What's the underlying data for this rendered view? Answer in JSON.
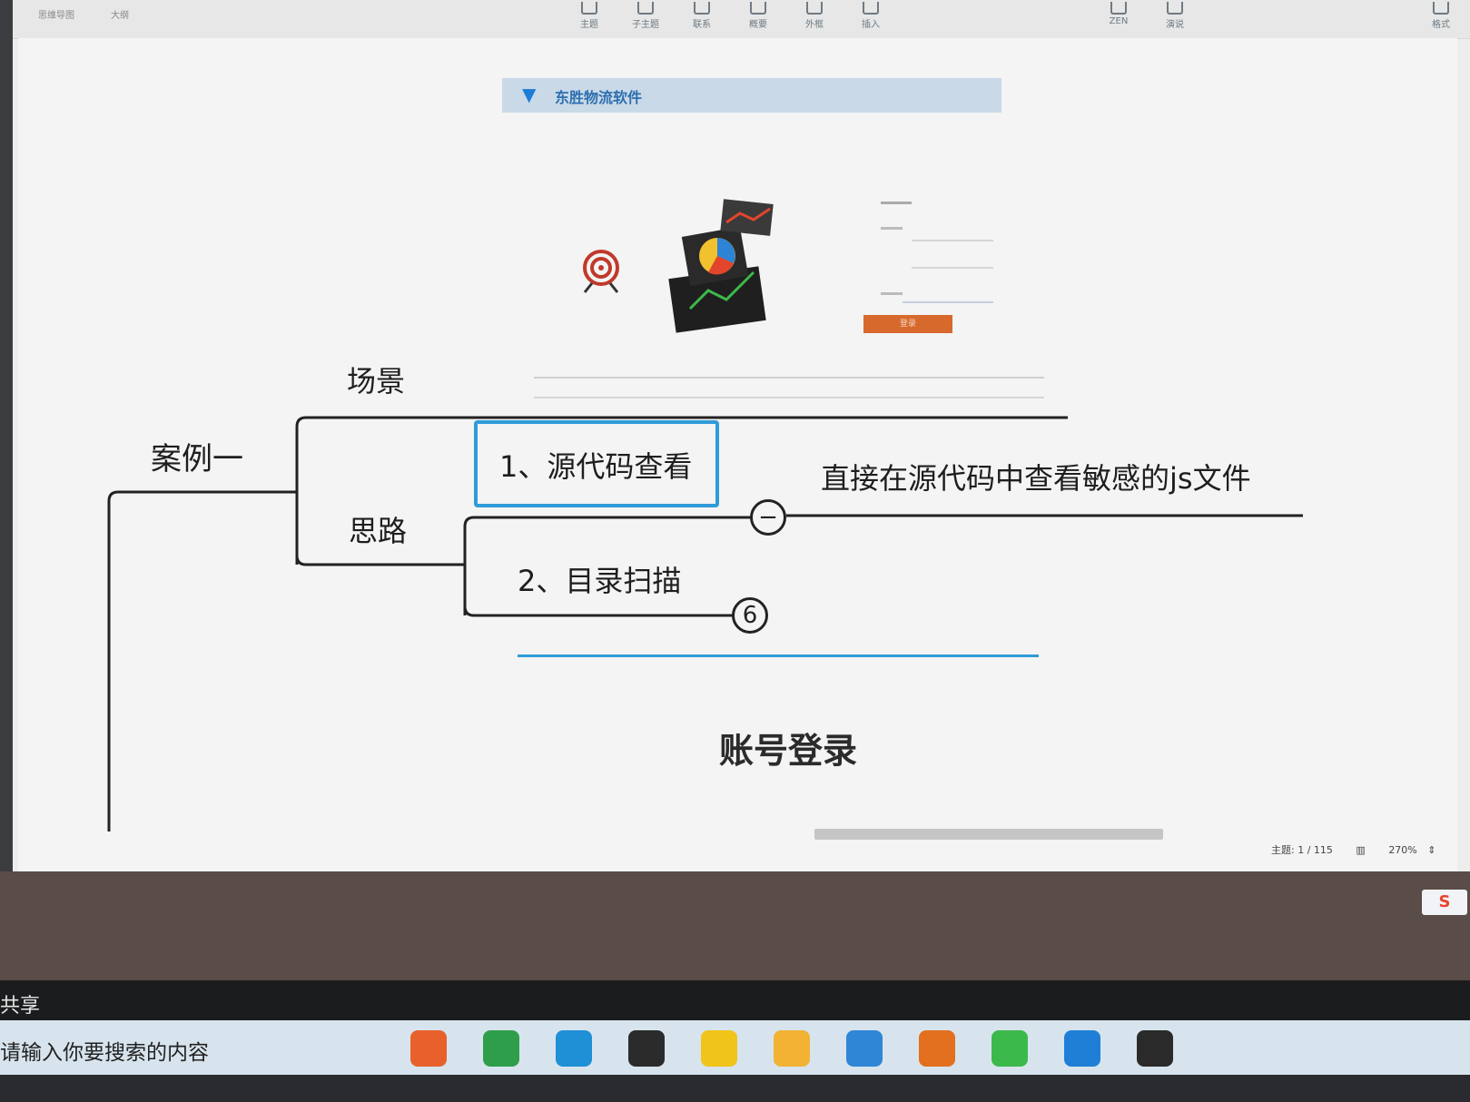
{
  "toolbar": {
    "tabs": [
      "思维导图",
      "大纲"
    ],
    "buttons": [
      {
        "label": "主题",
        "icon": "topic-icon"
      },
      {
        "label": "子主题",
        "icon": "subtopic-icon"
      },
      {
        "label": "联系",
        "icon": "relationship-icon"
      },
      {
        "label": "概要",
        "icon": "summary-icon"
      },
      {
        "label": "外框",
        "icon": "boundary-icon"
      },
      {
        "label": "插入",
        "icon": "insert-icon"
      },
      {
        "label": "ZEN",
        "icon": "zen-mode-icon"
      },
      {
        "label": "演说",
        "icon": "pitch-icon"
      },
      {
        "label": "格式",
        "icon": "format-panel-icon"
      }
    ]
  },
  "embed": {
    "brand": "东胜物流软件"
  },
  "mindmap": {
    "root": "案例一",
    "scene": "场景",
    "thinking": "思路",
    "step1": "1、源代码查看",
    "step1_note": "直接在源代码中查看敏感的js文件",
    "step2": "2、目录扫描",
    "step2_badge": "6",
    "collapse_symbol": "−",
    "section_title": "账号登录"
  },
  "status": {
    "topic_count": "主题: 1 / 115",
    "zoom": "270%"
  },
  "share_label": "共享",
  "taskbar": {
    "search_placeholder": "请输入你要搜索的内容",
    "apps": [
      {
        "name": "firefox-icon",
        "color": "#e8612c"
      },
      {
        "name": "chrome-icon",
        "color": "#2f9e4a"
      },
      {
        "name": "edge-icon",
        "color": "#1f8fd6"
      },
      {
        "name": "terminal-icon",
        "color": "#2b2b2b"
      },
      {
        "name": "sticky-notes-icon",
        "color": "#f0c419"
      },
      {
        "name": "file-explorer-icon",
        "color": "#f2b233"
      },
      {
        "name": "virtual-desktop-icon",
        "color": "#2f86d6"
      },
      {
        "name": "search-tool-icon",
        "color": "#e2701e"
      },
      {
        "name": "wechat-icon",
        "color": "#3cb94b"
      },
      {
        "name": "photos-icon",
        "color": "#1f7fd6"
      },
      {
        "name": "recorder-icon",
        "color": "#2a2a2a"
      }
    ]
  },
  "ime": {
    "label": "S"
  }
}
